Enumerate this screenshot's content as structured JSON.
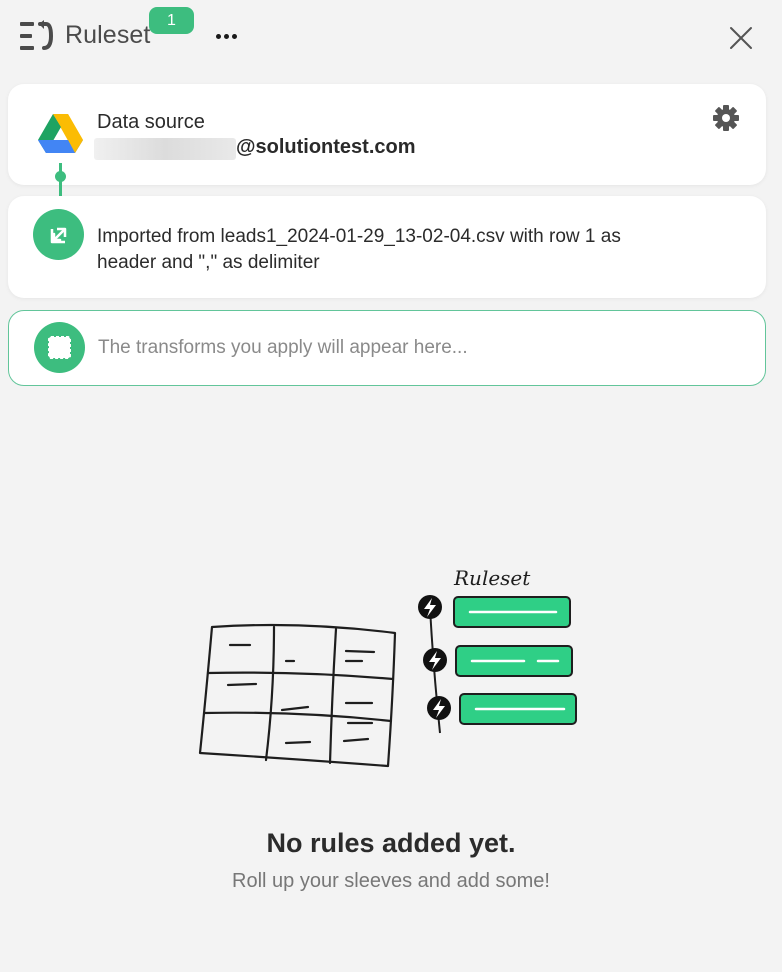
{
  "header": {
    "title": "Ruleset",
    "badge_count": "1",
    "logo_icon": "ruleset-logo-icon",
    "more_icon": "more-horizontal-icon",
    "close_icon": "close-icon"
  },
  "source_card": {
    "label": "Data source",
    "email_domain": "@solutiontest.com",
    "icon": "google-drive-icon",
    "settings_icon": "gear-icon"
  },
  "import_card": {
    "text": "Imported from leads1_2024-01-29_13-02-04.csv with row 1 as header and \",\" as delimiter",
    "icon": "import-arrow-icon"
  },
  "placeholder_card": {
    "text": "The transforms you apply will appear here...",
    "icon": "dashed-square-icon"
  },
  "illustration": {
    "title": "Ruleset"
  },
  "empty_state": {
    "title": "No rules added yet.",
    "subtitle": "Roll up your sleeves and add some!"
  },
  "colors": {
    "accent": "#3dbd7f",
    "background": "#f3f3f3",
    "card": "#ffffff",
    "rule_pill": "#2fcf86"
  }
}
